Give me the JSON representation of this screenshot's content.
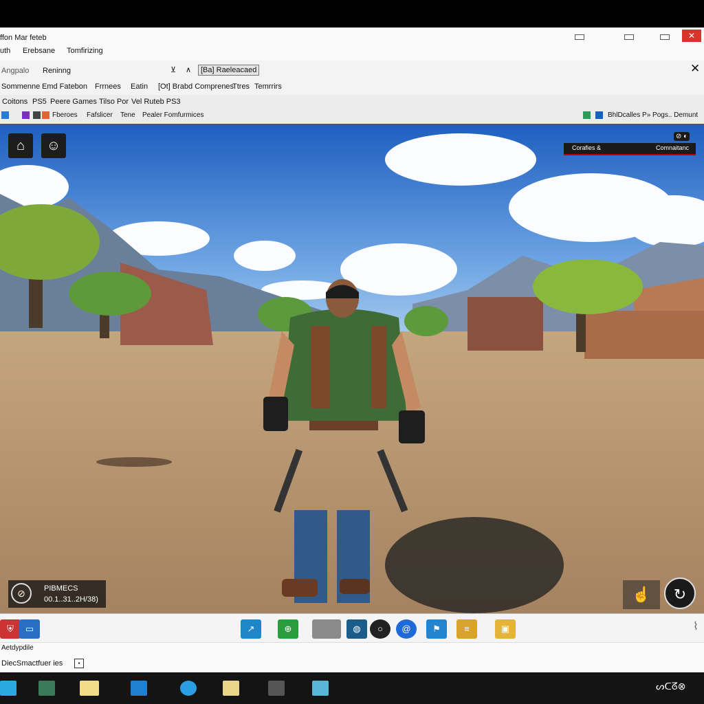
{
  "window": {
    "title": "ffon Mar feteb",
    "menu": [
      "uth",
      "Erebsane",
      "Tomfirizing"
    ]
  },
  "toolbar1": {
    "address_label": "Angpalo",
    "search_value": "Reninng",
    "ctrl_x": "⊻",
    "ctrl_up": "∧",
    "active_tab": "[Ba] Raeleacaed",
    "items": [
      "Sommenne",
      "Emd Fatebon",
      "Frrnees",
      "Eatin",
      "[Ot] Brabd Comprenes",
      "Ttres",
      "Temrrirs"
    ]
  },
  "toolbar2": {
    "tabs": [
      "Coitons",
      "PS5",
      "Peere Games",
      "Tilso Por",
      "Vel Ruteb PS3"
    ],
    "bookmarks": [
      "Fberoes",
      "Fafslicer",
      "Tene",
      "Pealer Fomfurmices"
    ],
    "right_text": "BhlDcalles P» Pogs.. Demunt"
  },
  "game": {
    "hud_status_left": "Corafies &",
    "hud_status_right": "Comnaitanc",
    "hud_top_right": "⊘ ◐",
    "player_name": "PIBMECS",
    "player_stats": "00.1..31..2H/38)",
    "sky_color": "#4a8ed8",
    "ground_color": "#b99a72"
  },
  "app_taskbar": {
    "icons": [
      "shield-icon",
      "window-icon",
      "arrow-app-icon",
      "xbox-icon",
      "gallery-icon",
      "network-icon",
      "search-ring-icon",
      "swirl-icon",
      "flag-icon",
      "notes-icon",
      "folder-icon"
    ]
  },
  "status_bar": {
    "line1": "Aetdypdile",
    "line2": "DiecSmactfuer ies"
  },
  "os_taskbar": {
    "tray_text": "ᔕᑕᘔ⊗",
    "icons": [
      "pen-icon",
      "grid-icon",
      "folder-icon",
      "edge-icon",
      "browser-icon",
      "files-icon",
      "terminal-icon",
      "image-icon"
    ]
  }
}
